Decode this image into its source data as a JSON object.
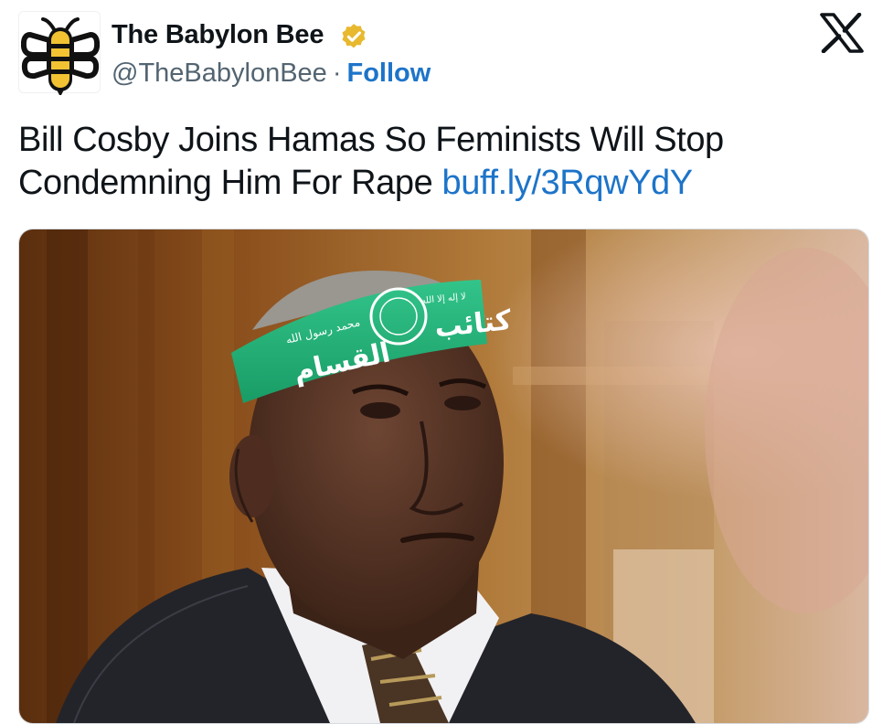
{
  "author": {
    "display_name": "The Babylon Bee",
    "handle": "@TheBabylonBee",
    "separator": "·",
    "follow_label": "Follow",
    "avatar_icon": "bee-logo-icon",
    "verified_icon": "verified-badge-icon",
    "verified_color": "#e8b82e"
  },
  "platform": {
    "logo_icon": "x-logo-icon"
  },
  "tweet": {
    "text": "Bill Cosby Joins Hamas So Feminists Will Stop Condemning Him For Rape ",
    "link_text": "buff.ly/3RqwYdY",
    "link_color": "#1d74c9"
  },
  "media": {
    "headband_text": "القسام",
    "headband_small_left": "محمد رسول الله",
    "headband_small_right": "لا إله إلا الله",
    "headband_text_right": "كتائب"
  }
}
